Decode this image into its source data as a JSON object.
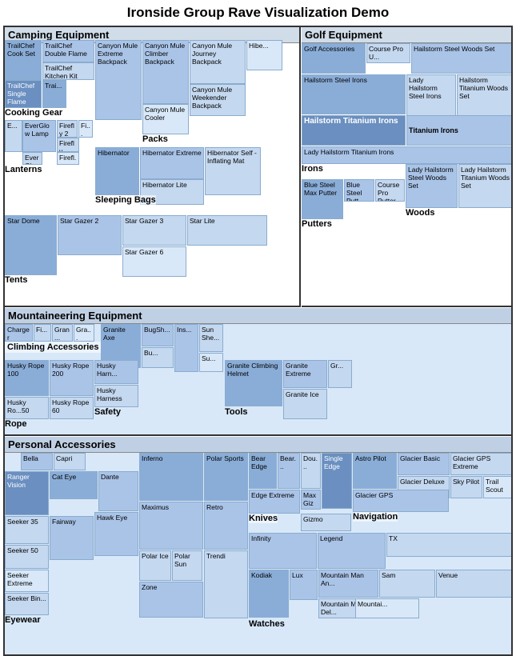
{
  "title": "Ironside Group Rave Visualization Demo",
  "sections": {
    "camping": "Camping Equipment",
    "golf": "Golf Equipment",
    "mountaineering": "Mountaineering Equipment",
    "personal": "Personal Accessories"
  },
  "camping_items": {
    "trailchef_cookset": "TrailChef Cook Set",
    "trailchef_double": "TrailChef Double Flame",
    "trailchef_kitchen": "TrailChef Kitchen Kit",
    "trailchef_single": "TrailChef Single Flame",
    "canyon_mule_climber": "Canyon Mule Climber Backpack",
    "canyon_mule_journey": "Canyon Mule Journey Backpack",
    "canyon_mule_cooler": "Canyon Mule Cooler",
    "canyon_mule_weekender": "Canyon Mule Weekender Backpack",
    "canyon_mule_extreme": "Canyon Mule Extreme Backpack",
    "packs": "Packs",
    "cooking_gear": "Cooking Gear",
    "everglow_lamp": "EverGlow Lamp",
    "firefly2": "Firefly 2",
    "firefly_mapr": "Firefly Mapr",
    "everglow": "EverGlow",
    "lanterns": "Lanterns",
    "hibernator": "Hibernator",
    "hibernator_extreme": "Hibernator Extreme",
    "hibernator_self_inflating": "Hibernator Self - Inflating Mat",
    "hibernator_lite": "Hibernator Lite",
    "sleeping_bags": "Sleeping Bags",
    "star_dome": "Star Dome",
    "star_gazer2": "Star Gazer 2",
    "star_gazer3": "Star Gazer 3",
    "star_gazer6": "Star Gazer 6",
    "star_lite": "Star Lite",
    "tents": "Tents"
  },
  "golf_items": {
    "hailstorm_steel_woods": "Hailstorm Steel Woods Set",
    "hailstorm_steel_irons": "Hailstorm Steel Irons",
    "hailstorm_titanium_woods": "Hailstorm Titanium Woods Set",
    "lady_hailstorm_steel": "Lady Hailstorm Steel Irons",
    "hailstorm_titanium_irons": "Hailstorm Titanium Irons",
    "lady_hailstorm_titanium": "Lady Hailstorm Titanium Irons",
    "lady_hailstorm_steel_woods": "Lady Hailstorm Steel Woods Set",
    "lady_hailstorm_titanium_woods": "Lady Hailstorm Titanium Woods Set",
    "titanium_irons": "Titanium Irons",
    "irons": "Irons",
    "woods": "Woods",
    "blue_steel_max": "Blue Steel Max Putter",
    "blue_steel_putter": "Blue Steel Putt...",
    "course_pro_putter": "Course Pro Putter",
    "putters": "Putters",
    "golf_accessories": "Golf Accessories",
    "course_pro_u": "Course Pro U..."
  },
  "mountain_items": {
    "charger": "Charger",
    "granite_axe": "Granite Axe",
    "bugshield": "BugSh...",
    "climbing_accessories": "Climbing Accessories",
    "husky_rope100": "Husky Rope 100",
    "husky_rope200": "Husky Rope 200",
    "husky_rope50": "Husky Ro...50",
    "husky_rope60": "Husky Rope 60",
    "husky_harness": "Husky Harn...",
    "husky_harness2": "Husky Harness",
    "granite_climbing": "Granite Climbing Helmet",
    "granite_extreme": "Granite Extreme",
    "granite_ice": "Granite Ice",
    "rope": "Rope",
    "safety": "Safety",
    "tools": "Tools",
    "insect": "Ins...",
    "sun_she": "Sun She...",
    "su": "Su..."
  },
  "personal_items": {
    "bella": "Bella",
    "capri": "Capri",
    "ranger_vision": "Ranger Vision",
    "cat_eye": "Cat Eye",
    "dante": "Dante",
    "seeker35": "Seeker 35",
    "seeker50": "Seeker 50",
    "seeker_extreme": "Seeker Extreme",
    "seeker_bin": "Seeker Bin...",
    "fairway": "Fairway",
    "hawk_eye": "Hawk Eye",
    "eyewear": "Eyewear",
    "inferno": "Inferno",
    "maximus": "Maximus",
    "polar_ice": "Polar Ice",
    "polar_sun": "Polar Sun",
    "zone": "Zone",
    "trendi": "Trendi",
    "retro": "Retro",
    "polar_sports": "Polar Sports",
    "bear_edge": "Bear Edge",
    "bear_griz": "Bear...",
    "double_edge": "Dou...",
    "max_gizmo": "Max Gizmo",
    "edge_extreme": "Edge Extreme",
    "single_edge": "Single Edge",
    "gizmo": "Gizmo",
    "knives": "Knives",
    "navigation": "Navigation",
    "astro_pilot": "Astro Pilot",
    "glacier_basic": "Glacier Basic",
    "glacier_gps_extreme": "Glacier GPS Extreme",
    "glacier_deluxe": "Glacier Deluxe",
    "sky_pilot": "Sky Pilot",
    "trail_scout": "Trail Scout",
    "glacier_gps": "Glacier GPS",
    "infinity": "Infinity",
    "legend": "Legend",
    "tx": "TX",
    "kodiak": "Kodiak",
    "lux": "Lux",
    "mountain_man_an": "Mountain Man An...",
    "mountain_man_del": "Mountain Man Del...",
    "sam": "Sam",
    "venue": "Venue",
    "watches": "Watches",
    "mountai": "Mountai..."
  }
}
